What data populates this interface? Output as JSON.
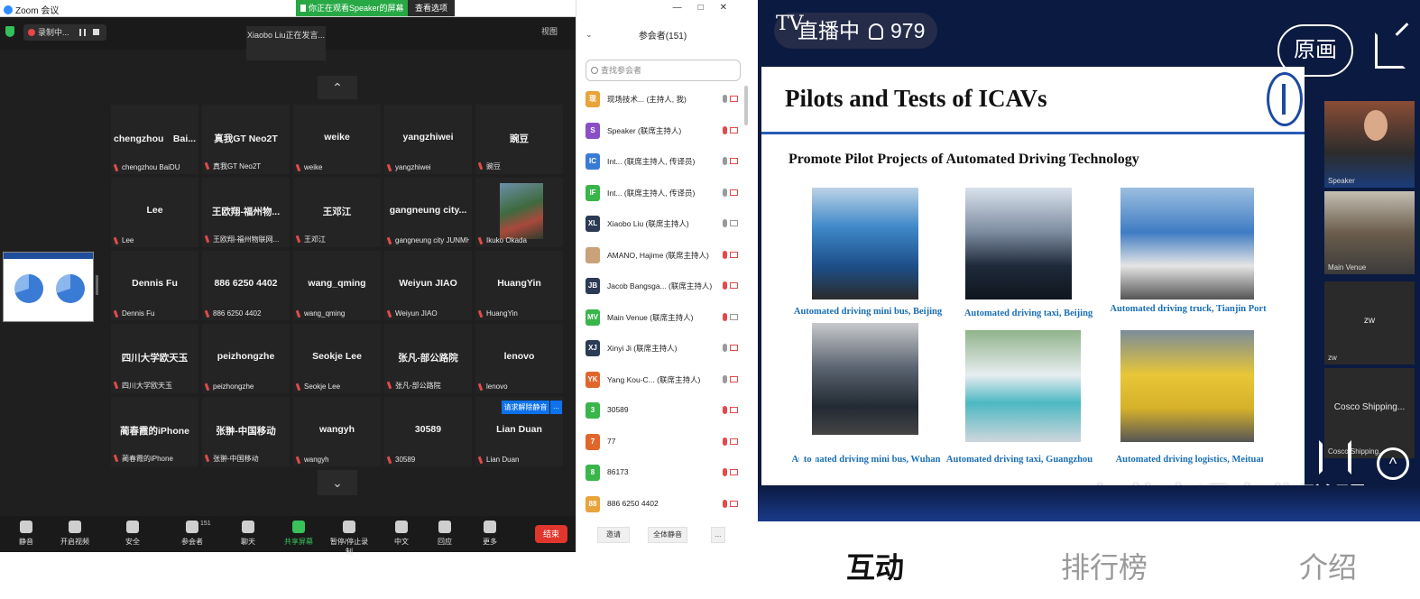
{
  "zoom": {
    "window_title": "Zoom 会议",
    "share_banner": "你正在观看Speaker的屏幕",
    "view_options": "查看选项",
    "recording_label": "录制中...",
    "speaking_label": "Xiaobo Liu正在发言...",
    "view_button": "视图",
    "grid": [
      [
        {
          "name": "chengzhou　Bai...",
          "label": "chengzhou BaiDU"
        },
        {
          "name": "真我GT Neo2T",
          "label": "真我GT Neo2T"
        },
        {
          "name": "weike",
          "label": "weike"
        },
        {
          "name": "yangzhiwei",
          "label": "yangzhiwei"
        },
        {
          "name": "豌豆",
          "label": "豌豆"
        }
      ],
      [
        {
          "name": "Lee",
          "label": "Lee"
        },
        {
          "name": "王欧翔-福州物...",
          "label": "王欧翔-福州物联网..."
        },
        {
          "name": "王邓江",
          "label": "王邓江"
        },
        {
          "name": "gangneung city...",
          "label": "gangneung city JUNMH..."
        },
        {
          "name": "",
          "label": "Ikuko Okada"
        }
      ],
      [
        {
          "name": "Dennis Fu",
          "label": "Dennis Fu"
        },
        {
          "name": "886 6250 4402",
          "label": "886 6250 4402"
        },
        {
          "name": "wang_qming",
          "label": "wang_qming"
        },
        {
          "name": "Weiyun JIAO",
          "label": "Weiyun JIAO"
        },
        {
          "name": "HuangYin",
          "label": "HuangYin"
        }
      ],
      [
        {
          "name": "四川大学欧天玉",
          "label": "四川大学欧天玉"
        },
        {
          "name": "peizhongzhe",
          "label": "peizhongzhe"
        },
        {
          "name": "Seokje Lee",
          "label": "Seokje Lee"
        },
        {
          "name": "张凡-部公路院",
          "label": "张凡-部公路院"
        },
        {
          "name": "lenovo",
          "label": "lenovo"
        }
      ],
      [
        {
          "name": "蔺春霞的iPhone",
          "label": "蔺春霞的iPhone"
        },
        {
          "name": "张翀-中国移动",
          "label": "张翀-中国移动"
        },
        {
          "name": "wangyh",
          "label": "wangyh"
        },
        {
          "name": "30589",
          "label": "30589"
        },
        {
          "name": "Lian Duan",
          "label": "Lian Duan"
        }
      ]
    ],
    "unmute_request": "请求解除静音",
    "unmute_more": "...",
    "toolbar": [
      {
        "label": "静音",
        "icon": "mic-icon"
      },
      {
        "label": "开启视频",
        "icon": "video-off-icon"
      },
      {
        "label": "安全",
        "icon": "shield-icon"
      },
      {
        "label": "参会者",
        "icon": "participants-icon",
        "badge": "151"
      },
      {
        "label": "聊天",
        "icon": "chat-icon"
      },
      {
        "label": "共享屏幕",
        "icon": "share-screen-icon"
      },
      {
        "label": "暂停/停止录制",
        "icon": "record-control-icon"
      },
      {
        "label": "中文",
        "icon": "language-icon"
      },
      {
        "label": "回应",
        "icon": "reaction-icon"
      },
      {
        "label": "更多",
        "icon": "more-icon"
      }
    ],
    "end_button": "结束"
  },
  "participants": {
    "title": "参会者(151)",
    "search_placeholder": "查找参会者",
    "window_controls": [
      "—",
      "□",
      "✕"
    ],
    "collapse": "⌄",
    "list": [
      {
        "initials": "现",
        "color": "#e8a33a",
        "name": "现场技术... (主持人, 我)",
        "mic_on": true,
        "cam_on": false
      },
      {
        "initials": "S",
        "color": "#8a4fc7",
        "name": "Speaker (联席主持人)",
        "mic_on": false,
        "cam_on": false
      },
      {
        "initials": "IC",
        "color": "#3a7bd5",
        "name": "Int... (联席主持人, 传译员)",
        "mic_on": true,
        "cam_on": false
      },
      {
        "initials": "IF",
        "color": "#39b54a",
        "name": "Int... (联席主持人, 传译员)",
        "mic_on": true,
        "cam_on": false
      },
      {
        "initials": "XL",
        "color": "#2b3a55",
        "name": "Xiaobo Liu (联席主持人)",
        "mic_on": true,
        "cam_on": true
      },
      {
        "initials": "",
        "color": "#c9a27a",
        "name": "AMANO, Hajime (联席主持人)",
        "mic_on": false,
        "cam_on": false
      },
      {
        "initials": "JB",
        "color": "#2b3a55",
        "name": "Jacob Bangsga... (联席主持人)",
        "mic_on": false,
        "cam_on": false
      },
      {
        "initials": "MV",
        "color": "#39b54a",
        "name": "Main Venue (联席主持人)",
        "mic_on": false,
        "cam_on": true
      },
      {
        "initials": "XJ",
        "color": "#2b3a55",
        "name": "Xinyi Ji (联席主持人)",
        "mic_on": true,
        "cam_on": false
      },
      {
        "initials": "YK",
        "color": "#e0662c",
        "name": "Yang Kou-C... (联席主持人)",
        "mic_on": true,
        "cam_on": false
      },
      {
        "initials": "3",
        "color": "#39b54a",
        "name": "30589",
        "mic_on": false,
        "cam_on": false
      },
      {
        "initials": "7",
        "color": "#e0662c",
        "name": "77",
        "mic_on": false,
        "cam_on": false
      },
      {
        "initials": "8",
        "color": "#39b54a",
        "name": "86173",
        "mic_on": false,
        "cam_on": false
      },
      {
        "initials": "88",
        "color": "#e8a33a",
        "name": "886 6250 4402",
        "mic_on": false,
        "cam_on": false
      }
    ],
    "invite": "邀请",
    "mute_all": "全体静音",
    "more": "..."
  },
  "live": {
    "tv_logo": "TV",
    "status": "直播中",
    "viewers": "979",
    "original_button": "原画",
    "slide": {
      "title": "Pilots and Tests of ICAVs",
      "subtitle": "Promote Pilot Projects of Automated Driving Technology",
      "captions": [
        "Automated driving mini bus,  Beijing",
        "Automated driving taxi, Beijing",
        "Automated driving truck, Tianjin Port",
        "Automated driving mini bus, Wuhan",
        "Automated driving taxi, Guangzhou",
        "Automated driving logistics, Meituan"
      ]
    },
    "side_videos": [
      {
        "label": "Speaker",
        "name": ""
      },
      {
        "label": "Main Venue",
        "name": ""
      },
      {
        "label": "zw",
        "name": "zw"
      },
      {
        "label": "Cosco Shipping...",
        "name": "Cosco Shipping..."
      }
    ],
    "watermark": "智能交通产业联盟",
    "up_arrow": "^",
    "tabs": [
      {
        "label": "互动",
        "active": true
      },
      {
        "label": "排行榜",
        "active": false
      },
      {
        "label": "介绍",
        "active": false
      }
    ]
  }
}
